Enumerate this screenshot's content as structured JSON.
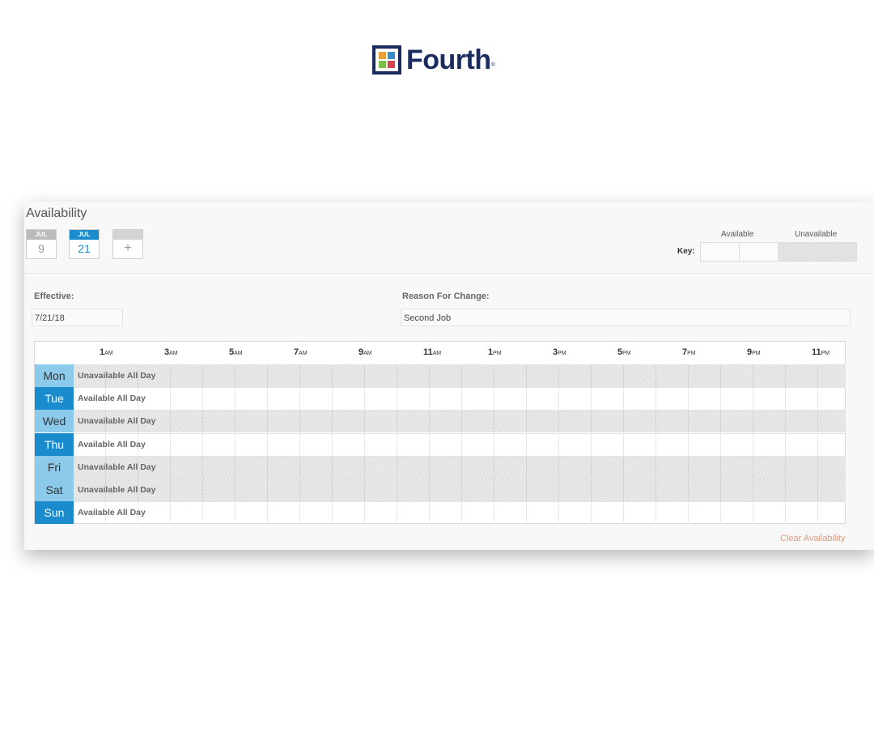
{
  "brand": {
    "name": "Fourth",
    "tm": "®"
  },
  "availability": {
    "title": "Availability",
    "dates": [
      {
        "month": "JUL",
        "day": "9",
        "active": false
      },
      {
        "month": "JUL",
        "day": "21",
        "active": true
      }
    ],
    "add_label": "+",
    "key": {
      "label": "Key:",
      "available": "Available",
      "unavailable": "Unavailable"
    }
  },
  "form": {
    "effective_label": "Effective:",
    "effective_value": "7/21/18",
    "reason_label": "Reason For Change:",
    "reason_value": "Second Job"
  },
  "schedule": {
    "hours": [
      {
        "num": "1",
        "suffix": "AM"
      },
      {
        "num": "3",
        "suffix": "AM"
      },
      {
        "num": "5",
        "suffix": "AM"
      },
      {
        "num": "7",
        "suffix": "AM"
      },
      {
        "num": "9",
        "suffix": "AM"
      },
      {
        "num": "11",
        "suffix": "AM"
      },
      {
        "num": "1",
        "suffix": "PM"
      },
      {
        "num": "3",
        "suffix": "PM"
      },
      {
        "num": "5",
        "suffix": "PM"
      },
      {
        "num": "7",
        "suffix": "PM"
      },
      {
        "num": "9",
        "suffix": "PM"
      },
      {
        "num": "11",
        "suffix": "PM"
      }
    ],
    "days": [
      {
        "name": "Mon",
        "status": "Unavailable All Day",
        "available": false
      },
      {
        "name": "Tue",
        "status": "Available All Day",
        "available": true
      },
      {
        "name": "Wed",
        "status": "Unavailable All Day",
        "available": false
      },
      {
        "name": "Thu",
        "status": "Available All Day",
        "available": true
      },
      {
        "name": "Fri",
        "status": "Unavailable All Day",
        "available": false
      },
      {
        "name": "Sat",
        "status": "Unavailable All Day",
        "available": false
      },
      {
        "name": "Sun",
        "status": "Available All Day",
        "available": true
      }
    ]
  },
  "actions": {
    "clear": "Clear Availability"
  },
  "colors": {
    "accent": "#1a8ccd",
    "unavailable_day": "#8ccaec",
    "brand_navy": "#1b2b5e",
    "link_orange": "#e39a7a"
  }
}
